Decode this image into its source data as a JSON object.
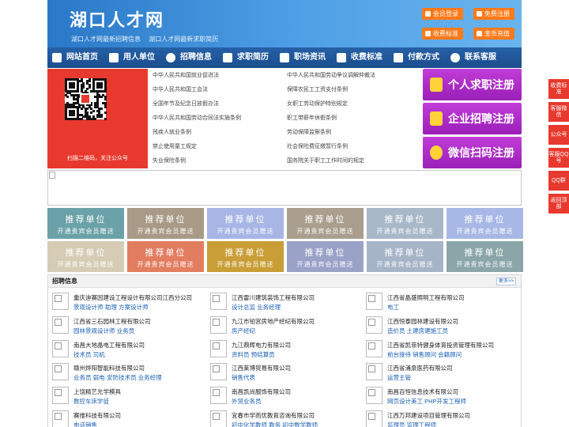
{
  "header": {
    "logo": "湖口人才网",
    "slogan": [
      "湖口人才网最新招聘信息",
      "湖口人才网最新求职简历"
    ],
    "buttons": [
      "会员登录",
      "免费注册",
      "收费标准",
      "金币充值"
    ]
  },
  "nav": {
    "items": [
      {
        "label": "网站首页",
        "icon": "home-icon"
      },
      {
        "label": "用人单位",
        "icon": "building-icon"
      },
      {
        "label": "招聘信息",
        "icon": "recruit-icon"
      },
      {
        "label": "求职简历",
        "icon": "resume-icon"
      },
      {
        "label": "职场资讯",
        "icon": "news-icon"
      },
      {
        "label": "收费标准",
        "icon": "money-icon"
      },
      {
        "label": "付款方式",
        "icon": "payment-icon"
      },
      {
        "label": "联系客服",
        "icon": "phone-icon"
      }
    ]
  },
  "qr": {
    "caption": "扫描二维码，关注公众号"
  },
  "laws": [
    [
      "中华人民共和国就业促进法",
      "中华人民共和国劳动争议调解仲裁法"
    ],
    [
      "中华人民共和国工会法",
      "保障农民工工资支付条例"
    ],
    [
      "全国年节及纪念日放假办法",
      "女职工劳动保护特别规定"
    ],
    [
      "中华人民共和国劳动合同法实施条例",
      "职工带薪年休假条例"
    ],
    [
      "残疾人就业条例",
      "劳动保障监察条例"
    ],
    [
      "禁止使用童工规定",
      "社会保险费征缴暂行条例"
    ],
    [
      "失业保险条例",
      "国务院关于职工工作时间的规定"
    ]
  ],
  "register": [
    "个人求职注册",
    "企业招聘注册",
    "微信扫码注册"
  ],
  "recommend": {
    "title": "推荐单位",
    "subtitle": "开通贵宾会员赠送",
    "colors": [
      "#6ba1a8",
      "#a89a86",
      "#a8b6e6",
      "#aa9e8e",
      "#a9b8c8",
      "#a8b8e6",
      "#d6ccb6",
      "#e27d60",
      "#c99e36",
      "#9aa2c8",
      "#a6b4c8",
      "#8aa6a8"
    ]
  },
  "recruit": {
    "title": "招聘信息",
    "more": "更多>>",
    "jobs": [
      {
        "company": "重庆迪赛因建设工程设计有限公司江西分公司",
        "position": "景观设计师·助理 方案设计师"
      },
      {
        "company": "江西雷川建筑装饰工程有限公司",
        "position": "设计总监 业务经理"
      },
      {
        "company": "江西省晶盛照明工程有限公司",
        "position": "电工"
      },
      {
        "company": "江西省三石园林工程有限公司",
        "position": "园林景观设计师 业务员"
      },
      {
        "company": "九江市铂宫房地产经纪有限公司",
        "position": "房产经纪"
      },
      {
        "company": "江西恒泰园林建设有限公司",
        "position": "造价员 土建房建施工员"
      },
      {
        "company": "南昌大地晶电工程有限公司",
        "position": "技术员 司机"
      },
      {
        "company": "九江鼎辉电力有限公司",
        "position": "资料员 预结算员"
      },
      {
        "company": "江西省凯菲特健身体育投资管理有限公司",
        "position": "前台接待 销售顾问 会籍顾问"
      },
      {
        "company": "赣州烨阳智能科技有限公司",
        "position": "业务员 弱电·安防技术员 业务经理"
      },
      {
        "company": "江西莱博贸易有限公司",
        "position": "销售代表"
      },
      {
        "company": "江西省涌泉医药有限公司",
        "position": "运营主管"
      },
      {
        "company": "上饶精艺光学模具",
        "position": "数控车床学徒"
      },
      {
        "company": "南昌凯尚服饰有限公司",
        "position": "外贸业务员"
      },
      {
        "company": "南昌百恒信息技术有限公司",
        "position": "网页设计美工 PHP开发工程师"
      },
      {
        "company": "赛维科技有限公司",
        "position": "电话销售"
      },
      {
        "company": "宜春市学而优教育咨询有限公司",
        "position": "初中化学教师 教务 初中数学教师"
      },
      {
        "company": "江西万邦建设项目管理有限公司",
        "position": "监理员 监理工程师"
      }
    ]
  },
  "side": [
    "收费标准",
    "客服微信",
    "公众号",
    "客服QQ号",
    "QQ群",
    "返回顶部"
  ]
}
